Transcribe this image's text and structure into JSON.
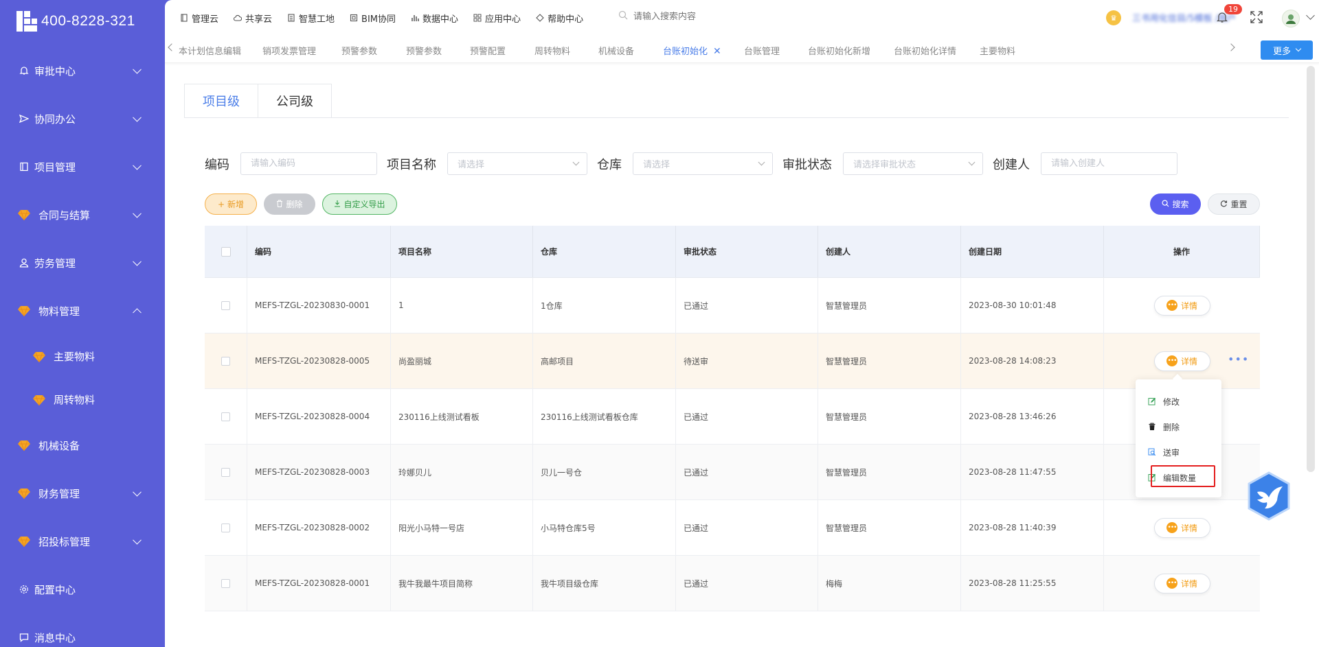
{
  "brand": {
    "phone": "400-8228-321"
  },
  "sidebar": {
    "items": [
      {
        "label": "审批中心",
        "icon": "bell-icon",
        "expanded": false
      },
      {
        "label": "协同办公",
        "icon": "send-icon",
        "expanded": false
      },
      {
        "label": "项目管理",
        "icon": "book-icon",
        "expanded": false
      },
      {
        "label": "合同与结算",
        "icon": "gem-icon",
        "expanded": false
      },
      {
        "label": "劳务管理",
        "icon": "user-icon",
        "expanded": false
      },
      {
        "label": "物料管理",
        "icon": "gem-icon",
        "expanded": true
      },
      {
        "label": "主要物料",
        "icon": "gem-icon",
        "sub": true
      },
      {
        "label": "周转物料",
        "icon": "gem-icon",
        "sub": true
      },
      {
        "label": "机械设备",
        "icon": "gem-icon",
        "expanded": false
      },
      {
        "label": "财务管理",
        "icon": "gem-icon",
        "expanded": false
      },
      {
        "label": "招投标管理",
        "icon": "gem-icon",
        "expanded": false
      },
      {
        "label": "配置中心",
        "icon": "gear-icon"
      },
      {
        "label": "消息中心",
        "icon": "message-icon"
      }
    ]
  },
  "topnav": {
    "items": [
      "管理云",
      "共享云",
      "智慧工地",
      "BIM协同",
      "数据中心",
      "应用中心",
      "帮助中心"
    ],
    "search_placeholder": "请输入搜索内容",
    "user_name": "三书用化信目/5模板 /用户",
    "notification_count": "19"
  },
  "tabbar": {
    "tabs": [
      "本计划信息编辑",
      "销项发票管理",
      "预警参数",
      "预警参数",
      "预警配置",
      "周转物料",
      "机械设备",
      "台账初始化",
      "台账管理",
      "台账初始化新增",
      "台账初始化详情",
      "主要物料"
    ],
    "active_index": 7,
    "more_label": "更多"
  },
  "level_tabs": [
    "项目级",
    "公司级"
  ],
  "filters": {
    "code_label": "编码",
    "code_placeholder": "请输入编码",
    "project_label": "项目名称",
    "project_placeholder": "请选择",
    "warehouse_label": "仓库",
    "warehouse_placeholder": "请选择",
    "status_label": "审批状态",
    "status_placeholder": "请选择审批状态",
    "creator_label": "创建人",
    "creator_placeholder": "请输入创建人"
  },
  "actions": {
    "add": "新增",
    "delete": "删除",
    "export": "自定义导出",
    "search": "搜索",
    "reset": "重置"
  },
  "table": {
    "headers": [
      "编码",
      "项目名称",
      "仓库",
      "审批状态",
      "创建人",
      "创建日期",
      "操作"
    ],
    "detail_label": "详情",
    "rows": [
      {
        "code": "MEFS-TZGL-20230830-0001",
        "project": "1",
        "warehouse": "1仓库",
        "status": "已通过",
        "creator": "智慧管理员",
        "date": "2023-08-30 10:01:48"
      },
      {
        "code": "MEFS-TZGL-20230828-0005",
        "project": "尚盈丽城",
        "warehouse": "高邮项目",
        "status": "待送审",
        "creator": "智慧管理员",
        "date": "2023-08-28 14:08:23"
      },
      {
        "code": "MEFS-TZGL-20230828-0004",
        "project": "230116上线测试看板",
        "warehouse": "230116上线测试看板仓库",
        "status": "已通过",
        "creator": "智慧管理员",
        "date": "2023-08-28 13:46:26"
      },
      {
        "code": "MEFS-TZGL-20230828-0003",
        "project": "玲娜贝儿",
        "warehouse": "贝儿一号仓",
        "status": "已通过",
        "creator": "智慧管理员",
        "date": "2023-08-28 11:47:55"
      },
      {
        "code": "MEFS-TZGL-20230828-0002",
        "project": "阳光小马特一号店",
        "warehouse": "小马特仓库5号",
        "status": "已通过",
        "creator": "智慧管理员",
        "date": "2023-08-28 11:40:39"
      },
      {
        "code": "MEFS-TZGL-20230828-0001",
        "project": "我牛我最牛项目简称",
        "warehouse": "我牛项目级仓库",
        "status": "已通过",
        "creator": "梅梅",
        "date": "2023-08-28 11:25:55"
      }
    ]
  },
  "dropdown": {
    "items": [
      "修改",
      "删除",
      "送审",
      "编辑数量"
    ]
  },
  "colors": {
    "sidebar": "#5a5ed8",
    "accent": "#4a7de8",
    "orange": "#f29b11",
    "highlight": "#e41e1e"
  }
}
